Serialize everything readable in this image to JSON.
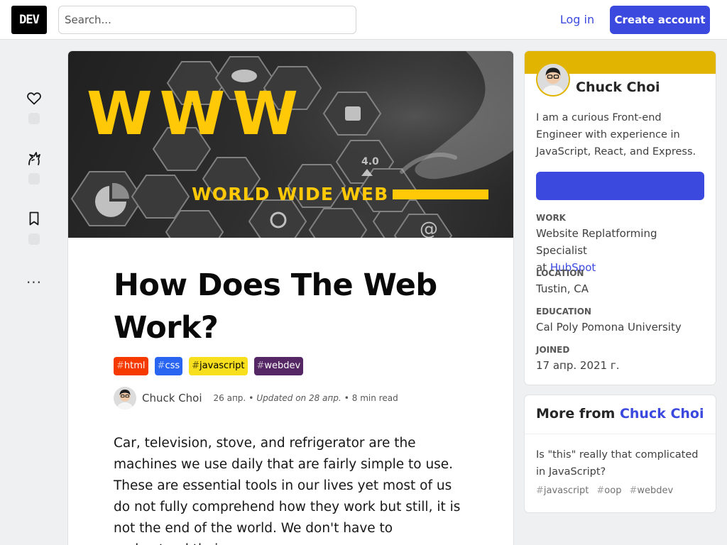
{
  "header": {
    "logo": "DEV",
    "search_placeholder": "Search...",
    "login_label": "Log in",
    "create_account_label": "Create account"
  },
  "reactions": {
    "heart_icon": "heart-icon",
    "unicorn_icon": "unicorn-icon",
    "bookmark_icon": "bookmark-icon",
    "more_label": "..."
  },
  "article": {
    "cover": {
      "headline": "WWW",
      "subheadline": "WORLD WIDE WEB",
      "accent_color": "#ffc907"
    },
    "title": "How Does The Web Work?",
    "tags": [
      {
        "hash": "#",
        "name": "html",
        "color": "#f53900"
      },
      {
        "hash": "#",
        "name": "css",
        "color": "#2965f1"
      },
      {
        "hash": "#",
        "name": "javascript",
        "color": "#f7df1e",
        "text_color": "#000000"
      },
      {
        "hash": "#",
        "name": "webdev",
        "color": "#562765"
      }
    ],
    "author": "Chuck Choi",
    "date": "26 апр.",
    "sep": "•",
    "updated": "Updated on 28 апр.",
    "read_time": "8 min read",
    "body": "Car, television, stove, and refrigerator are the machines we use daily that are fairly simple to use. These are essential tools in our lives yet most of us do not fully comprehend how they work but still, it is not the end of the world. We don't have to understand their"
  },
  "sidebar": {
    "profile": {
      "name": "Chuck Choi",
      "bio": "I am a curious Front-end Engineer with experience in JavaScript, React, and Express.",
      "brand_color": "#e0b400",
      "work_label": "WORK",
      "work_title": "Website Replatforming Specialist",
      "work_at": "at",
      "work_company": "HubSpot",
      "location_label": "LOCATION",
      "location": "Tustin, CA",
      "education_label": "EDUCATION",
      "education": "Cal Poly Pomona University",
      "joined_label": "JOINED",
      "joined": "17 апр. 2021 г."
    },
    "more_from": {
      "prefix": "More from",
      "author": "Chuck Choi",
      "post_title": "Is \"this\" really that complicated in JavaScript?",
      "tags": [
        {
          "hash": "#",
          "name": "javascript"
        },
        {
          "hash": "#",
          "name": "oop"
        },
        {
          "hash": "#",
          "name": "webdev"
        }
      ]
    }
  }
}
